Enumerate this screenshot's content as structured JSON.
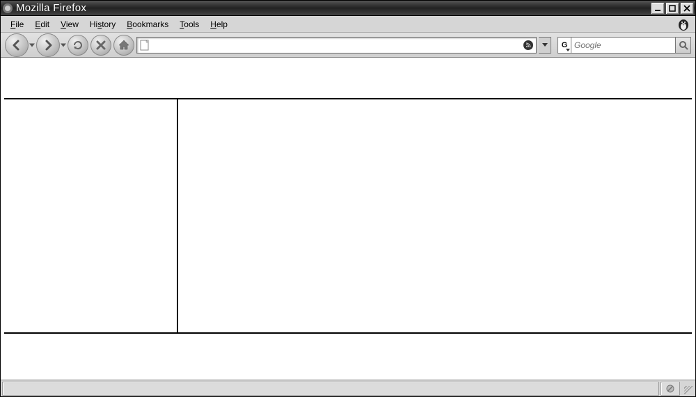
{
  "window": {
    "title": "Mozilla Firefox"
  },
  "menu": {
    "file": "File",
    "edit": "Edit",
    "view": "View",
    "history": "History",
    "bookmarks": "Bookmarks",
    "tools": "Tools",
    "help": "Help"
  },
  "toolbar": {
    "address_value": "",
    "search_engine_letter": "G",
    "search_placeholder": "Google"
  },
  "status": {
    "text": ""
  }
}
